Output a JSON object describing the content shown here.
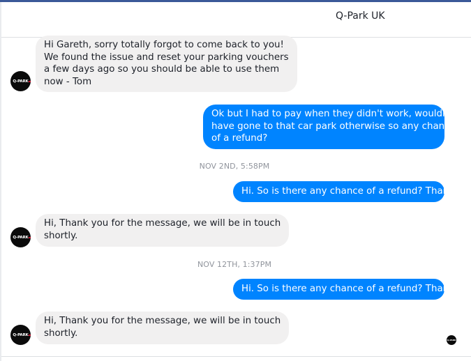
{
  "header": {
    "title": "Q-Park UK"
  },
  "avatar": {
    "logo_text": "Q-PARK",
    "icon": "q-park-logo-icon"
  },
  "messages": [
    {
      "lines": [
        "Hi Gareth, sorry totally forgot to come back to you!",
        "We found the issue and reset your parking vouchers",
        "a few days ago so you should be able to use them",
        "now - Tom"
      ]
    },
    {
      "lines": [
        "Ok but I had to pay when they didn't work, wouldn't",
        "have gone to that car park otherwise so any chance",
        "of a refund?"
      ]
    },
    {
      "text": "NOV 2ND, 5:58PM"
    },
    {
      "text": "Hi. So is there any chance of a refund? Thanks"
    },
    {
      "lines": [
        "Hi, Thank you for the message, we will be in touch",
        "shortly."
      ]
    },
    {
      "text": "NOV 12TH, 1:37PM"
    },
    {
      "text": "Hi. So is there any chance of a refund? Thanks"
    },
    {
      "lines": [
        "Hi, Thank you for the message, we will be in touch",
        "shortly."
      ]
    }
  ],
  "colors": {
    "outgoing": "#0084ff",
    "incoming": "#f1f0f0",
    "accent": "#3b5998"
  }
}
